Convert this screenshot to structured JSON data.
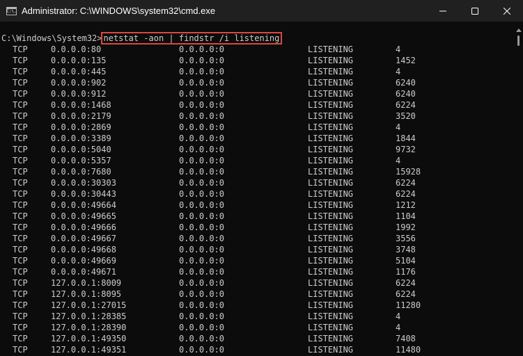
{
  "window": {
    "title": "Administrator: C:\\WINDOWS\\system32\\cmd.exe",
    "icon_text": "C:\\."
  },
  "console": {
    "prompt": "C:\\Windows\\System32>",
    "command": "netstat -aon | findstr /i listening",
    "rows": [
      [
        "TCP",
        "0.0.0.0:80",
        "0.0.0.0:0",
        "LISTENING",
        "4"
      ],
      [
        "TCP",
        "0.0.0.0:135",
        "0.0.0.0:0",
        "LISTENING",
        "1452"
      ],
      [
        "TCP",
        "0.0.0.0:445",
        "0.0.0.0:0",
        "LISTENING",
        "4"
      ],
      [
        "TCP",
        "0.0.0.0:902",
        "0.0.0.0:0",
        "LISTENING",
        "6240"
      ],
      [
        "TCP",
        "0.0.0.0:912",
        "0.0.0.0:0",
        "LISTENING",
        "6240"
      ],
      [
        "TCP",
        "0.0.0.0:1468",
        "0.0.0.0:0",
        "LISTENING",
        "6224"
      ],
      [
        "TCP",
        "0.0.0.0:2179",
        "0.0.0.0:0",
        "LISTENING",
        "3520"
      ],
      [
        "TCP",
        "0.0.0.0:2869",
        "0.0.0.0:0",
        "LISTENING",
        "4"
      ],
      [
        "TCP",
        "0.0.0.0:3389",
        "0.0.0.0:0",
        "LISTENING",
        "1844"
      ],
      [
        "TCP",
        "0.0.0.0:5040",
        "0.0.0.0:0",
        "LISTENING",
        "9732"
      ],
      [
        "TCP",
        "0.0.0.0:5357",
        "0.0.0.0:0",
        "LISTENING",
        "4"
      ],
      [
        "TCP",
        "0.0.0.0:7680",
        "0.0.0.0:0",
        "LISTENING",
        "15928"
      ],
      [
        "TCP",
        "0.0.0.0:30303",
        "0.0.0.0:0",
        "LISTENING",
        "6224"
      ],
      [
        "TCP",
        "0.0.0.0:30443",
        "0.0.0.0:0",
        "LISTENING",
        "6224"
      ],
      [
        "TCP",
        "0.0.0.0:49664",
        "0.0.0.0:0",
        "LISTENING",
        "1212"
      ],
      [
        "TCP",
        "0.0.0.0:49665",
        "0.0.0.0:0",
        "LISTENING",
        "1104"
      ],
      [
        "TCP",
        "0.0.0.0:49666",
        "0.0.0.0:0",
        "LISTENING",
        "1992"
      ],
      [
        "TCP",
        "0.0.0.0:49667",
        "0.0.0.0:0",
        "LISTENING",
        "3556"
      ],
      [
        "TCP",
        "0.0.0.0:49668",
        "0.0.0.0:0",
        "LISTENING",
        "3748"
      ],
      [
        "TCP",
        "0.0.0.0:49669",
        "0.0.0.0:0",
        "LISTENING",
        "5104"
      ],
      [
        "TCP",
        "0.0.0.0:49671",
        "0.0.0.0:0",
        "LISTENING",
        "1176"
      ],
      [
        "TCP",
        "127.0.0.1:8009",
        "0.0.0.0:0",
        "LISTENING",
        "6224"
      ],
      [
        "TCP",
        "127.0.0.1:8095",
        "0.0.0.0:0",
        "LISTENING",
        "6224"
      ],
      [
        "TCP",
        "127.0.0.1:27015",
        "0.0.0.0:0",
        "LISTENING",
        "11280"
      ],
      [
        "TCP",
        "127.0.0.1:28385",
        "0.0.0.0:0",
        "LISTENING",
        "4"
      ],
      [
        "TCP",
        "127.0.0.1:28390",
        "0.0.0.0:0",
        "LISTENING",
        "4"
      ],
      [
        "TCP",
        "127.0.0.1:49350",
        "0.0.0.0:0",
        "LISTENING",
        "7408"
      ],
      [
        "TCP",
        "127.0.0.1:49351",
        "0.0.0.0:0",
        "LISTENING",
        "11480"
      ]
    ]
  },
  "colors": {
    "background": "#0c0c0c",
    "text": "#cccccc",
    "titlebar": "#202020",
    "highlight_box": "#e0463d"
  },
  "icons": {
    "minimize": "minimize-icon",
    "maximize": "maximize-icon",
    "close": "close-icon",
    "app": "cmd-app-icon"
  }
}
